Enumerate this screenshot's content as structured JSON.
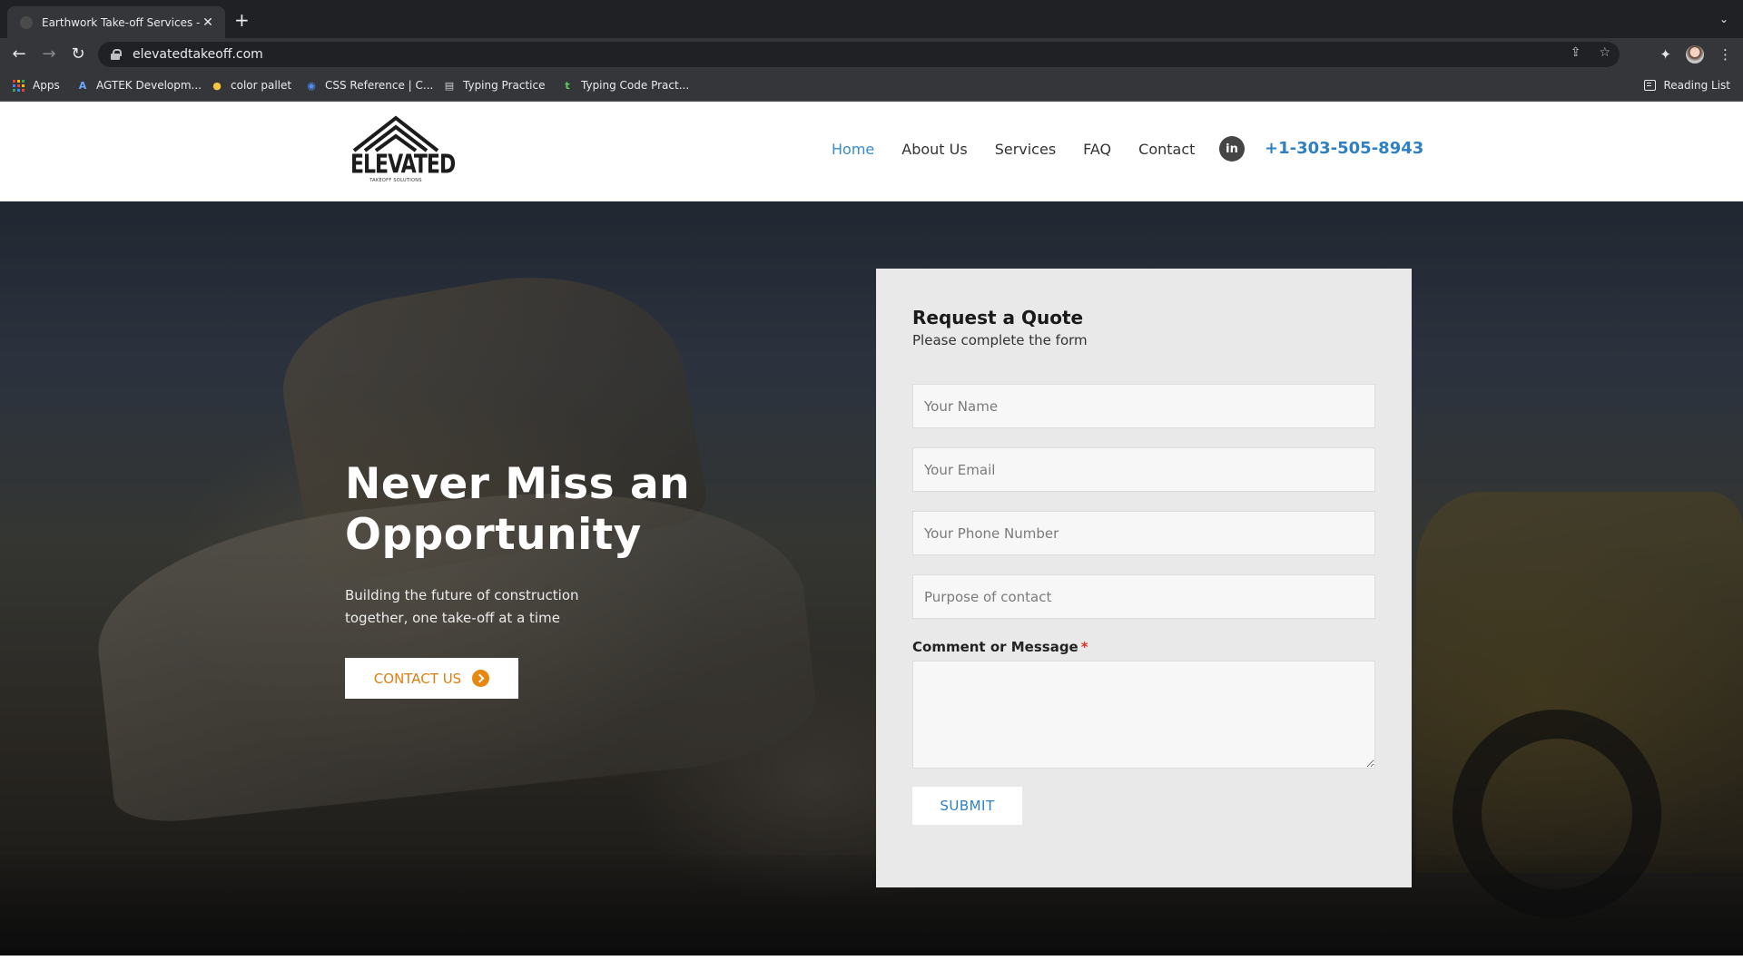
{
  "browser": {
    "tab_title": "Earthwork Take-off Services - Elevated Takeoff Solutions",
    "tab_close": "✕",
    "new_tab": "+",
    "tab_menu": "⌄",
    "url": "elevatedtakeoff.com",
    "nav_back": "←",
    "nav_forward": "→",
    "nav_reload": "↻",
    "share_glyph": "⇪",
    "bookmark_glyph": "☆",
    "extensions_glyph": "✦",
    "menu_glyph": "⋮",
    "bookmarks": [
      {
        "label": "Apps",
        "icon": "apps-grid-icon"
      },
      {
        "label": "AGTEK Developm...",
        "icon": "agtek-icon",
        "glyph": "A"
      },
      {
        "label": "color pallet",
        "icon": "color-pallet-icon",
        "glyph": "●"
      },
      {
        "label": "CSS Reference | C...",
        "icon": "css-reference-icon",
        "glyph": "◉"
      },
      {
        "label": "Typing Practice",
        "icon": "typing-practice-icon",
        "glyph": "▤"
      },
      {
        "label": "Typing Code Pract...",
        "icon": "typing-code-icon",
        "glyph": "t"
      }
    ],
    "reading_list": "Reading List"
  },
  "site": {
    "logo_text": "ELEVATED",
    "logo_sub": "TAKEOFF SOLUTIONS",
    "nav": [
      "Home",
      "About Us",
      "Services",
      "FAQ",
      "Contact"
    ],
    "active_nav": "Home",
    "linkedin_glyph": "in",
    "phone": "+1-303-505-8943"
  },
  "hero": {
    "title_line1": "Never Miss an",
    "title_line2": "Opportunity",
    "subtitle": "Building the future of construction together, one take-off at a time",
    "cta_label": "CONTACT US"
  },
  "form": {
    "title": "Request a Quote",
    "subtitle": "Please complete the form",
    "name_placeholder": "Your Name",
    "email_placeholder": "Your Email",
    "phone_placeholder": "Your Phone Number",
    "purpose_placeholder": "Purpose of contact",
    "message_label": "Comment or Message",
    "required_mark": "*",
    "submit_label": "SUBMIT"
  },
  "colors": {
    "accent_blue": "#2f80c2",
    "cta_orange": "#e07f10",
    "form_bg": "#e9e9ea",
    "chrome_dark": "#202124"
  }
}
